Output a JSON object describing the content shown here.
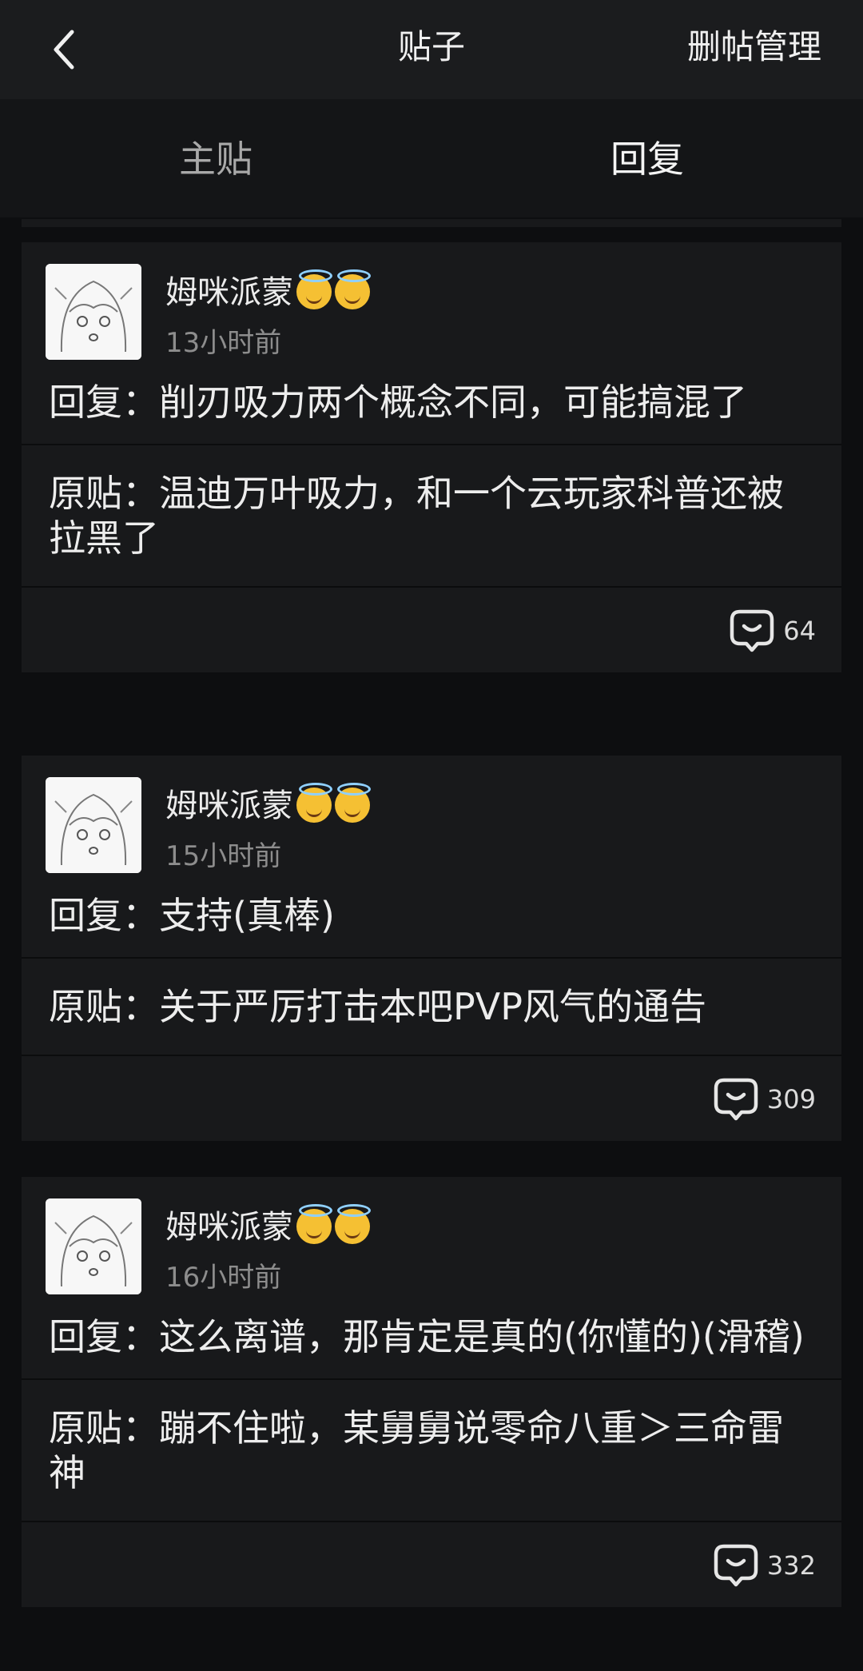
{
  "header": {
    "title": "贴子",
    "manage_label": "删帖管理"
  },
  "tabs": [
    {
      "label": "主贴",
      "active": false
    },
    {
      "label": "回复",
      "active": true
    }
  ],
  "posts": [
    {
      "username": "姆咪派蒙",
      "time": "13小时前",
      "reply": "回复：削刃吸力两个概念不同，可能搞混了",
      "original": "原贴：温迪万叶吸力，和一个云玩家科普还被拉黑了",
      "comments": "64"
    },
    {
      "username": "姆咪派蒙",
      "time": "15小时前",
      "reply": "回复：支持(真棒)",
      "original": "原贴：关于严厉打击本吧PVP风气的通告",
      "comments": "309"
    },
    {
      "username": "姆咪派蒙",
      "time": "16小时前",
      "reply": "回复：这么离谱，那肯定是真的(你懂的)(滑稽)",
      "original": "原贴：蹦不住啦，某舅舅说零命八重＞三命雷神",
      "comments": "332"
    }
  ],
  "icons": {
    "back": "chevron-left-icon",
    "comment": "comment-bubble-icon",
    "badge": "halo-smile-emoji"
  },
  "colors": {
    "background": "#0d0e10",
    "card": "#18191b",
    "header": "#1b1c1e",
    "text": "#ececec",
    "muted": "#8d8d8d"
  }
}
